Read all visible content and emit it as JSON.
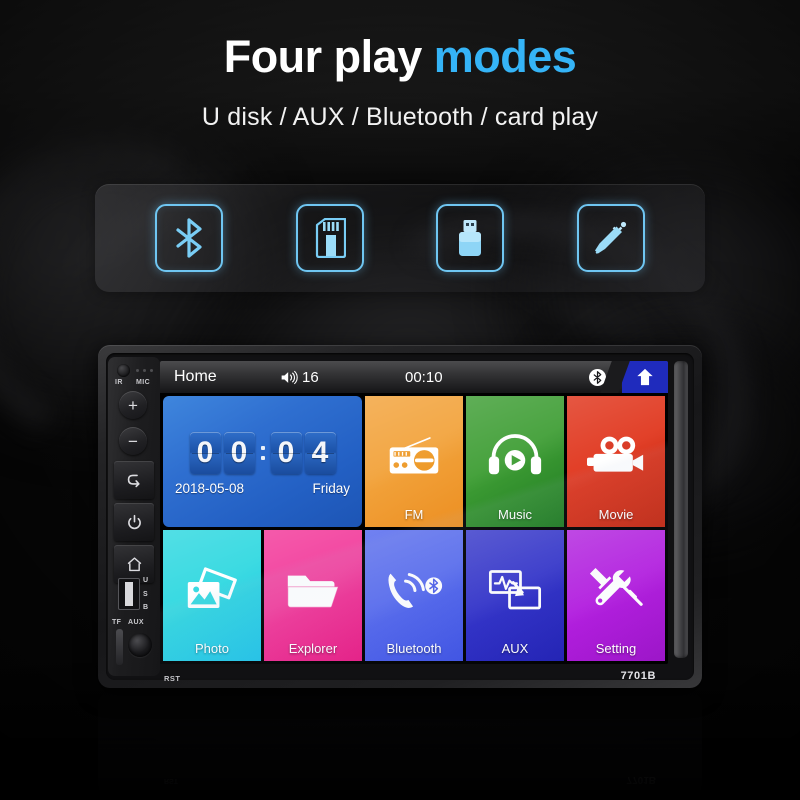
{
  "headline": {
    "plain": "Four play ",
    "accent": "modes"
  },
  "subhead": "U disk / AUX / Bluetooth / card play",
  "accent_color": "#35b4f7",
  "icon_panel": {
    "items": [
      {
        "name": "bluetooth-icon",
        "label": "Bluetooth"
      },
      {
        "name": "sd-card-icon",
        "label": "SD card"
      },
      {
        "name": "usb-drive-icon",
        "label": "U disk"
      },
      {
        "name": "aux-jack-icon",
        "label": "AUX"
      }
    ],
    "icon_color": "#6fc6f2"
  },
  "device": {
    "model": "7701B",
    "reset_label": "RST",
    "left_panel": {
      "ir_label": "IR",
      "mic_label": "MIC",
      "volume_up": "+",
      "volume_down": "−",
      "back": "back-arrow",
      "power": "power",
      "home": "home",
      "usb_letters": [
        "U",
        "S",
        "B"
      ],
      "tf_label": "TF",
      "aux_label": "AUX"
    },
    "statusbar": {
      "title": "Home",
      "volume": "16",
      "time": "00:10",
      "bluetooth": "bluetooth-icon",
      "home_key": "home-up-arrow"
    },
    "clock": {
      "hours": [
        "0",
        "0"
      ],
      "minutes": [
        "0",
        "4"
      ],
      "date": "2018-05-08",
      "weekday": "Friday",
      "color": "#2360c4"
    },
    "tiles": [
      {
        "label": "FM",
        "icon": "radio-icon",
        "color": "#f2a33c",
        "color2": "#ec8f22"
      },
      {
        "label": "Music",
        "icon": "headphones-icon",
        "color": "#3f9e35",
        "color2": "#1f7a22"
      },
      {
        "label": "Movie",
        "icon": "camcorder-icon",
        "color": "#e0351c",
        "color2": "#c22a14"
      },
      {
        "label": "Photo",
        "icon": "photos-icon",
        "color": "#2fd8e0",
        "color2": "#22c3e8"
      },
      {
        "label": "Explorer",
        "icon": "folder-icon",
        "color": "#f2399a",
        "color2": "#e81d86"
      },
      {
        "label": "Bluetooth",
        "icon": "phone-bt-icon",
        "color": "#5468ee",
        "color2": "#3f53e4"
      },
      {
        "label": "AUX",
        "icon": "aux-transfer-icon",
        "color": "#2f2fc9",
        "color2": "#2222b4"
      },
      {
        "label": "Setting",
        "icon": "tools-icon",
        "color": "#b41ae0",
        "color2": "#9c16c8"
      }
    ]
  }
}
